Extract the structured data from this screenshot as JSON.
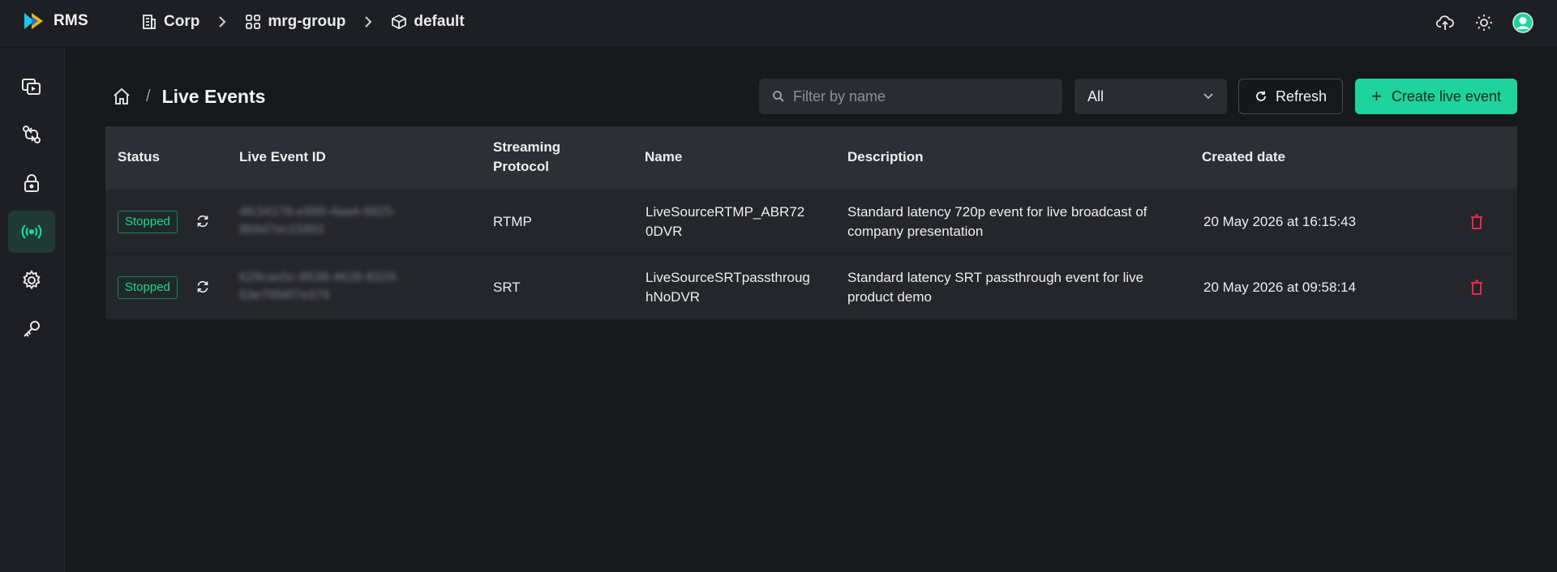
{
  "app": {
    "name": "RMS",
    "brand_colors": {
      "logo_left": "#18c7e6",
      "logo_right": "#f5c400",
      "accent": "#1fd49c",
      "danger": "#e8294f"
    }
  },
  "topbar": {
    "breadcrumbs": [
      {
        "label": "Corp",
        "icon": "building-icon"
      },
      {
        "label": "mrg-group",
        "icon": "grid-icon"
      },
      {
        "label": "default",
        "icon": "cube-icon"
      }
    ],
    "actions": [
      "upload-icon",
      "sun-icon",
      "avatar-icon"
    ]
  },
  "sidebar": {
    "items": [
      {
        "icon": "media-library-icon",
        "active": false
      },
      {
        "icon": "transfer-icon",
        "active": false
      },
      {
        "icon": "lock-icon",
        "active": false
      },
      {
        "icon": "live-broadcast-icon",
        "active": true
      },
      {
        "icon": "gear-icon",
        "active": false
      },
      {
        "icon": "key-icon",
        "active": false
      }
    ]
  },
  "page": {
    "title": "Live Events",
    "home_icon": "home-icon",
    "separator": "/"
  },
  "toolbar": {
    "filter_placeholder": "Filter by name",
    "filter_value": "",
    "select_value": "All",
    "refresh_label": "Refresh",
    "create_label": "Create live event",
    "create_plus": "+"
  },
  "table": {
    "headers": {
      "status": "Status",
      "id": "Live Event ID",
      "protocol_line1": "Streaming",
      "protocol_line2": "Protocol",
      "name": "Name",
      "description": "Description",
      "created": "Created date"
    },
    "rows": [
      {
        "status": "Stopped",
        "id_line1": "4fc34178-e999-4aa4-9925-",
        "id_line2": "8b9d7ec15891",
        "protocol": "RTMP",
        "name_line1": "LiveSourceRTMP_ABR72",
        "name_line2": "0DVR",
        "desc_line1": "Standard latency 720p event for live broadcast of",
        "desc_line2": "company presentation",
        "created": "20 May 2026 at 16:15:43"
      },
      {
        "status": "Stopped",
        "id_line1": "629cae5c-8538-4628-8329-",
        "id_line2": "53e7656f7e379",
        "protocol": "SRT",
        "name_line1": "LiveSourceSRTpassthroug",
        "name_line2": "hNoDVR",
        "desc_line1": "Standard latency SRT passthrough event for live",
        "desc_line2": "product demo",
        "created": "20 May 2026 at 09:58:14"
      }
    ]
  }
}
